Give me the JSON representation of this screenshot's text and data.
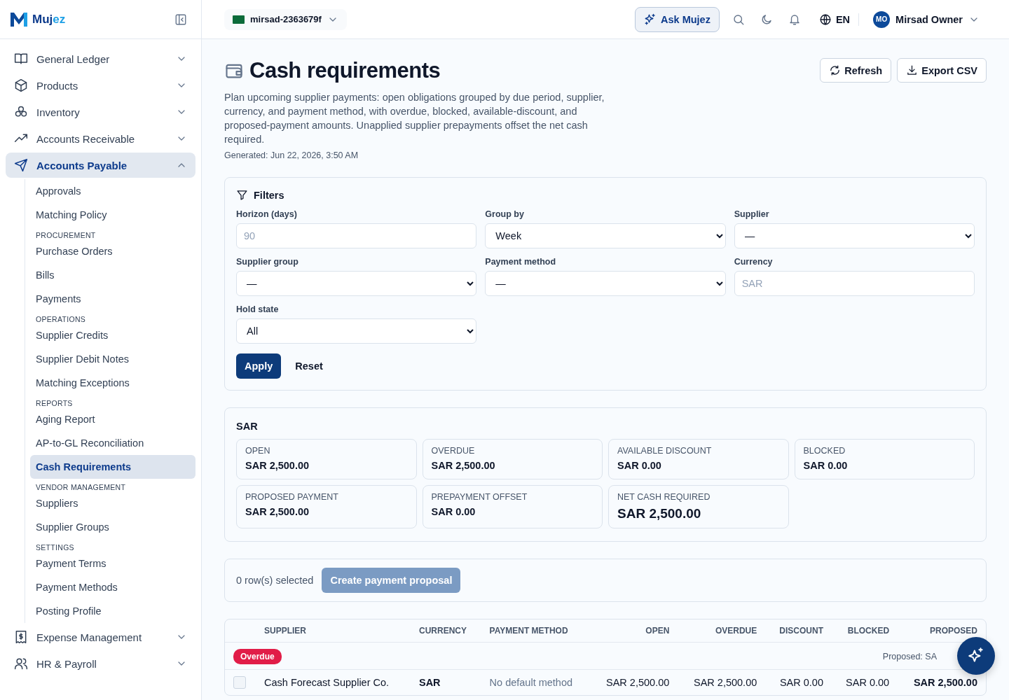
{
  "brand": {
    "parts": [
      "Muj",
      "ez"
    ]
  },
  "nav": [
    {
      "kind": "group",
      "label": "General Ledger",
      "expanded": false,
      "selected": false
    },
    {
      "kind": "group",
      "label": "Products",
      "expanded": false,
      "selected": false
    },
    {
      "kind": "group",
      "label": "Inventory",
      "expanded": false,
      "selected": false
    },
    {
      "kind": "group",
      "label": "Accounts Receivable",
      "expanded": false,
      "selected": false
    },
    {
      "kind": "group",
      "label": "Accounts Payable",
      "expanded": true,
      "selected": true,
      "children": [
        {
          "kind": "link",
          "label": "Approvals",
          "selected": false
        },
        {
          "kind": "link",
          "label": "Matching Policy",
          "selected": false
        },
        {
          "kind": "section",
          "label": "PROCUREMENT"
        },
        {
          "kind": "link",
          "label": "Purchase Orders",
          "selected": false
        },
        {
          "kind": "link",
          "label": "Bills",
          "selected": false
        },
        {
          "kind": "link",
          "label": "Payments",
          "selected": false
        },
        {
          "kind": "section",
          "label": "OPERATIONS"
        },
        {
          "kind": "link",
          "label": "Supplier Credits",
          "selected": false
        },
        {
          "kind": "link",
          "label": "Supplier Debit Notes",
          "selected": false
        },
        {
          "kind": "link",
          "label": "Matching Exceptions",
          "selected": false
        },
        {
          "kind": "section",
          "label": "REPORTS"
        },
        {
          "kind": "link",
          "label": "Aging Report",
          "selected": false
        },
        {
          "kind": "link",
          "label": "AP-to-GL Reconciliation",
          "selected": false
        },
        {
          "kind": "link",
          "label": "Cash Requirements",
          "selected": true
        },
        {
          "kind": "section",
          "label": "VENDOR MANAGEMENT"
        },
        {
          "kind": "link",
          "label": "Suppliers",
          "selected": false
        },
        {
          "kind": "link",
          "label": "Supplier Groups",
          "selected": false
        },
        {
          "kind": "section",
          "label": "SETTINGS"
        },
        {
          "kind": "link",
          "label": "Payment Terms",
          "selected": false
        },
        {
          "kind": "link",
          "label": "Payment Methods",
          "selected": false
        },
        {
          "kind": "link",
          "label": "Posting Profile",
          "selected": false
        }
      ]
    },
    {
      "kind": "group",
      "label": "Expense Management",
      "expanded": false,
      "selected": false
    },
    {
      "kind": "group",
      "label": "HR & Payroll",
      "expanded": false,
      "selected": false
    }
  ],
  "topbar": {
    "org": "mirsad-2363679f",
    "ask": "Ask Mujez",
    "language": "EN",
    "user": {
      "initials": "MO",
      "name": "Mirsad Owner"
    }
  },
  "page": {
    "title": "Cash requirements",
    "description": "Plan upcoming supplier payments: open obligations grouped by due period, supplier, currency, and payment method, with overdue, blocked, available-discount, and proposed-payment amounts. Unapplied supplier prepayments offset the net cash required.",
    "generated": "Generated: Jun 22, 2026, 3:50 AM",
    "actions": [
      "Refresh",
      "Export CSV"
    ]
  },
  "filters": {
    "title": "Filters",
    "fields": [
      {
        "kind": "input",
        "label": "Horizon (days)",
        "placeholder": "90"
      },
      {
        "kind": "select",
        "label": "Group by",
        "value": "Week"
      },
      {
        "kind": "select",
        "label": "Supplier",
        "value": "—"
      },
      {
        "kind": "select",
        "label": "Supplier group",
        "value": "—"
      },
      {
        "kind": "select",
        "label": "Payment method",
        "value": "—"
      },
      {
        "kind": "input",
        "label": "Currency",
        "placeholder": "SAR"
      },
      {
        "kind": "select",
        "label": "Hold state",
        "value": "All"
      }
    ],
    "apply": "Apply",
    "reset": "Reset"
  },
  "summary": {
    "currency": "SAR",
    "metrics": [
      {
        "kind": "amount",
        "label": "OPEN",
        "value": "SAR 2,500.00"
      },
      {
        "kind": "amount",
        "label": "OVERDUE",
        "value": "SAR 2,500.00"
      },
      {
        "kind": "amount",
        "label": "AVAILABLE DISCOUNT",
        "value": "SAR 0.00"
      },
      {
        "kind": "amount",
        "label": "BLOCKED",
        "value": "SAR 0.00"
      },
      {
        "kind": "amount",
        "label": "PROPOSED PAYMENT",
        "value": "SAR 2,500.00"
      },
      {
        "kind": "amount",
        "label": "PREPAYMENT OFFSET",
        "value": "SAR 0.00"
      },
      {
        "kind": "total",
        "label": "NET CASH REQUIRED",
        "value": "SAR 2,500.00"
      }
    ]
  },
  "selection": {
    "count": "0 row(s) selected",
    "button": "Create payment proposal",
    "disabled": true
  },
  "table": {
    "columns": [
      {
        "label": "SUPPLIER"
      },
      {
        "label": "CURRENCY"
      },
      {
        "label": "PAYMENT METHOD"
      },
      {
        "label": "OPEN"
      },
      {
        "label": "OVERDUE"
      },
      {
        "label": "DISCOUNT"
      },
      {
        "label": "BLOCKED"
      },
      {
        "label": "PROPOSED"
      }
    ],
    "groups": [
      {
        "badge": "Overdue",
        "summary": "Proposed: SA",
        "rows": [
          {
            "checked": false,
            "cells": [
              "Cash Forecast Supplier Co.",
              "SAR",
              "No default method",
              "SAR 2,500.00",
              "SAR 2,500.00",
              "SAR 0.00",
              "SAR 0.00",
              "SAR 2,500.00"
            ]
          }
        ]
      }
    ]
  }
}
